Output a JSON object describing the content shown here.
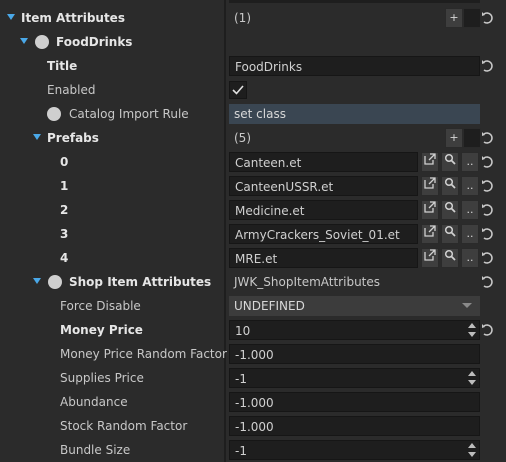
{
  "rows": [
    {
      "label": "Item Attributes",
      "value": "(1)"
    },
    {
      "label": "FoodDrinks",
      "value": ""
    },
    {
      "label": "Title",
      "value": "FoodDrinks"
    },
    {
      "label": "Enabled",
      "checked": true
    },
    {
      "label": "Catalog Import Rule",
      "value": "set class"
    },
    {
      "label": "Prefabs",
      "value": "(5)"
    },
    {
      "label": "0",
      "value": "Canteen.et"
    },
    {
      "label": "1",
      "value": "CanteenUSSR.et"
    },
    {
      "label": "2",
      "value": "Medicine.et"
    },
    {
      "label": "3",
      "value": "ArmyCrackers_Soviet_01.et"
    },
    {
      "label": "4",
      "value": "MRE.et"
    },
    {
      "label": "Shop Item Attributes",
      "value": "JWK_ShopItemAttributes"
    },
    {
      "label": "Force Disable",
      "value": "UNDEFINED"
    },
    {
      "label": "Money Price",
      "value": "10"
    },
    {
      "label": "Money Price Random Factor",
      "value": "-1.000"
    },
    {
      "label": "Supplies Price",
      "value": "-1"
    },
    {
      "label": "Abundance",
      "value": "-1.000"
    },
    {
      "label": "Stock Random Factor",
      "value": "-1.000"
    },
    {
      "label": "Bundle Size",
      "value": "-1"
    }
  ],
  "buttons": {
    "add": "+",
    "browse": ".."
  },
  "colors": {
    "accent": "#4aa8e8",
    "field": "#1e1e1e",
    "background": "#2b2b2b"
  }
}
